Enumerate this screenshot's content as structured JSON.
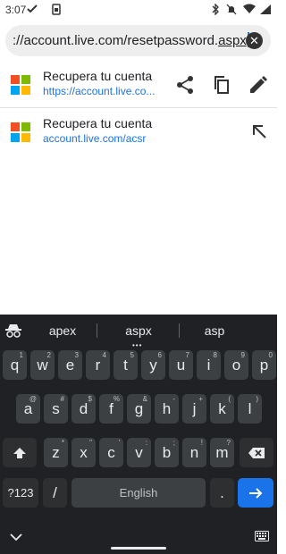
{
  "status": {
    "time": "3:07"
  },
  "address_bar": {
    "url_prefix": "://account.live.com/resetpassword.",
    "url_selected": "aspx"
  },
  "suggestions": [
    {
      "title": "Recupera tu cuenta",
      "url": "https://account.live.co..."
    },
    {
      "title": "Recupera tu cuenta",
      "url": "account.live.com/acsr"
    }
  ],
  "keyboard": {
    "suggestions": [
      "apex",
      "aspx",
      "asp"
    ],
    "row1": [
      {
        "k": "q",
        "h": "1"
      },
      {
        "k": "w",
        "h": "2"
      },
      {
        "k": "e",
        "h": "3"
      },
      {
        "k": "r",
        "h": "4"
      },
      {
        "k": "t",
        "h": "5"
      },
      {
        "k": "y",
        "h": "6"
      },
      {
        "k": "u",
        "h": "7"
      },
      {
        "k": "i",
        "h": "8"
      },
      {
        "k": "o",
        "h": "9"
      },
      {
        "k": "p",
        "h": "0"
      }
    ],
    "row2": [
      {
        "k": "a",
        "h": "@"
      },
      {
        "k": "s",
        "h": "#"
      },
      {
        "k": "d",
        "h": "$"
      },
      {
        "k": "f",
        "h": "%"
      },
      {
        "k": "g",
        "h": "&"
      },
      {
        "k": "h",
        "h": "-"
      },
      {
        "k": "j",
        "h": "+"
      },
      {
        "k": "k",
        "h": "("
      },
      {
        "k": "l",
        "h": ")"
      }
    ],
    "row3": [
      {
        "k": "z",
        "h": "*"
      },
      {
        "k": "x",
        "h": "\""
      },
      {
        "k": "c",
        "h": "'"
      },
      {
        "k": "v",
        "h": ":"
      },
      {
        "k": "b",
        "h": ";"
      },
      {
        "k": "n",
        "h": "!"
      },
      {
        "k": "m",
        "h": "?"
      }
    ],
    "symbols_label": "?123",
    "slash_label": "/",
    "space_label": "English",
    "period_label": "."
  },
  "colors": {
    "accent": "#1a73e8",
    "keyboard_bg": "#202124",
    "key_bg": "#3c4043",
    "ms_red": "#f25022",
    "ms_green": "#7fba00",
    "ms_blue": "#00a4ef",
    "ms_yellow": "#ffb900"
  }
}
